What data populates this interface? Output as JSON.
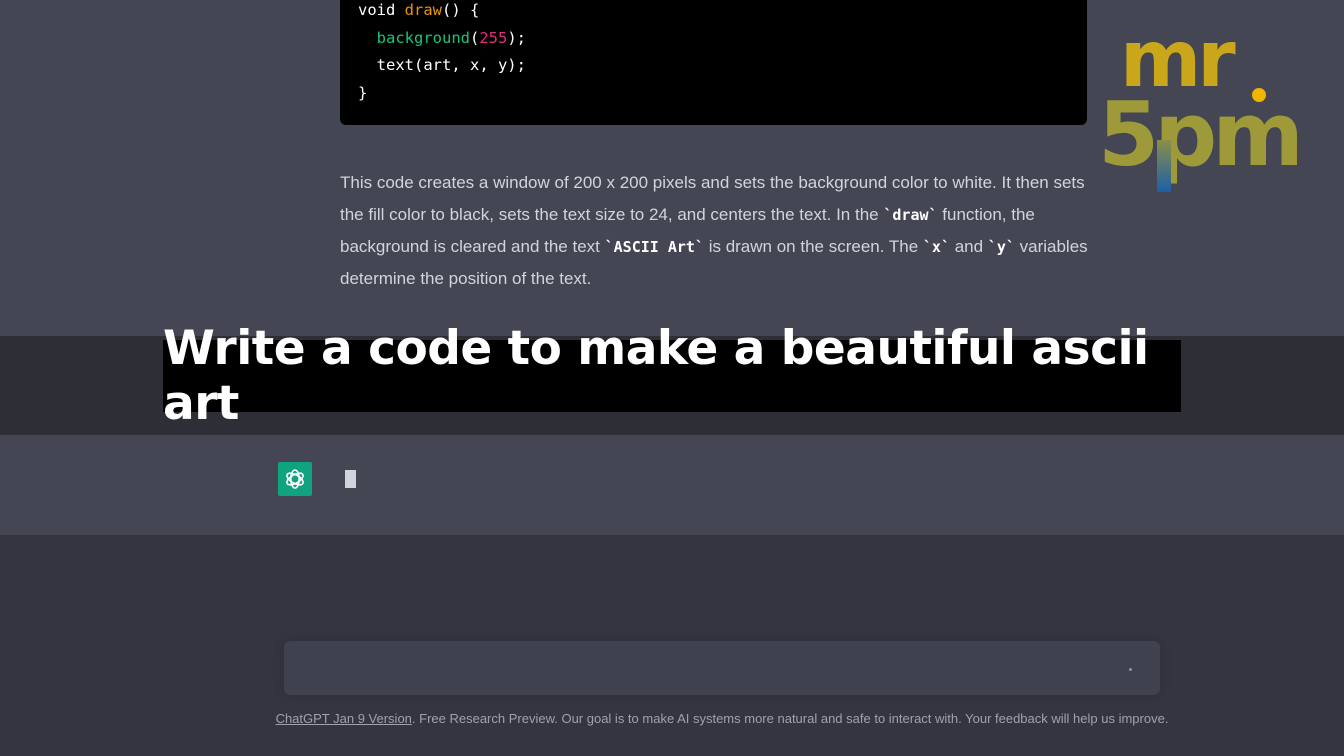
{
  "code": {
    "line1_kw": "void ",
    "line1_fn": "draw",
    "line1_rest": "() {",
    "line2_indent": "  ",
    "line2_fn": "background",
    "line2_open": "(",
    "line2_num": "255",
    "line2_close": ");",
    "line3": "  text(art, x, y);",
    "line4": "}"
  },
  "explanation": {
    "part1": "This code creates a window of 200 x 200 pixels and sets the background color to white. It then sets the fill color to black, sets the text size to 24, and centers the text. In the ",
    "code1": "`draw`",
    "part2": " function, the background is cleared and the text ",
    "code2": "`ASCII Art`",
    "part3": " is drawn on the screen. The ",
    "code3": "`x`",
    "part4": " and ",
    "code4": "`y`",
    "part5": " variables determine the position of the text."
  },
  "logo": {
    "line1": "mr",
    "line2": "5pm",
    "icon": "mr5pm-logo"
  },
  "caption": "Write a code to make a beautiful ascii art",
  "assistant": {
    "avatar_icon": "openai-logo-icon",
    "cursor": ""
  },
  "input": {
    "value": "",
    "send_icon": "send-icon"
  },
  "footer": {
    "link": "ChatGPT Jan 9 Version",
    "text": ". Free Research Preview. Our goal is to make AI systems more natural and safe to interact with. Your feedback will help us improve."
  },
  "colors": {
    "accent_green": "#10a37f",
    "code_function": "#e9950c",
    "code_builtin": "#19c37d",
    "code_number": "#df3079",
    "logo_yellow": "#f1b500"
  }
}
